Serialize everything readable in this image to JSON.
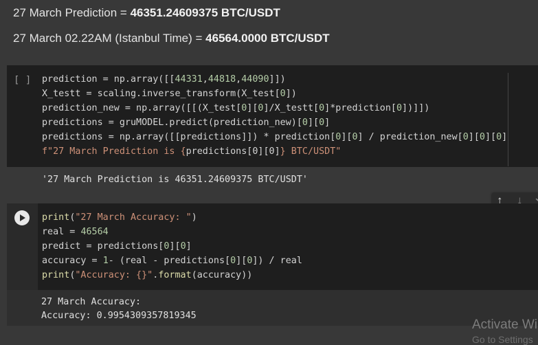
{
  "markdown": {
    "line1_prefix": "27 March Prediction = ",
    "line1_value": "46351.24609375 BTC/USDT",
    "line2_prefix": "27 March 02.22AM (Istanbul Time) = ",
    "line2_value": "46564.0000 BTC/USDT"
  },
  "cell1": {
    "exec_label": "[ ]",
    "code_lines": [
      [
        [
          "t",
          "prediction = np.array([["
        ],
        [
          "n",
          "44331"
        ],
        [
          "t",
          ","
        ],
        [
          "n",
          "44818"
        ],
        [
          "t",
          ","
        ],
        [
          "n",
          "44090"
        ],
        [
          "t",
          "]])"
        ]
      ],
      [
        [
          "t",
          "X_testt = scaling.inverse_transform(X_test["
        ],
        [
          "n",
          "0"
        ],
        [
          "t",
          "])"
        ]
      ],
      [
        [
          "t",
          "prediction_new = np.array([[(X_test["
        ],
        [
          "n",
          "0"
        ],
        [
          "t",
          "]["
        ],
        [
          "n",
          "0"
        ],
        [
          "t",
          "]/X_testt["
        ],
        [
          "n",
          "0"
        ],
        [
          "t",
          "]*prediction["
        ],
        [
          "n",
          "0"
        ],
        [
          "t",
          "])]])"
        ]
      ],
      [
        [
          "t",
          "predictions = gruMODEL.predict(prediction_new)["
        ],
        [
          "n",
          "0"
        ],
        [
          "t",
          "]["
        ],
        [
          "n",
          "0"
        ],
        [
          "t",
          "]"
        ]
      ],
      [
        [
          "t",
          "predictions = np.array([[predictions]]) * prediction["
        ],
        [
          "n",
          "0"
        ],
        [
          "t",
          "]["
        ],
        [
          "n",
          "0"
        ],
        [
          "t",
          "] / prediction_new["
        ],
        [
          "n",
          "0"
        ],
        [
          "t",
          "]["
        ],
        [
          "n",
          "0"
        ],
        [
          "t",
          "]["
        ],
        [
          "n",
          "0"
        ],
        [
          "t",
          "]"
        ]
      ],
      [
        [
          "s",
          "f\"27 March Prediction is {"
        ],
        [
          "t",
          "predictions[0][0]"
        ],
        [
          "s",
          "} BTC/USDT\""
        ]
      ]
    ],
    "output": "'27 March Prediction is 46351.24609375 BTC/USDT'"
  },
  "toolbar": {
    "up_icon": "arrow-up-icon",
    "down_icon": "arrow-down-icon"
  },
  "cell2": {
    "code_lines": [
      [
        [
          "f",
          "print"
        ],
        [
          "t",
          "("
        ],
        [
          "s",
          "\"27 March Accuracy: \""
        ],
        [
          "t",
          ")"
        ]
      ],
      [
        [
          "t",
          "real = "
        ],
        [
          "n",
          "46564"
        ]
      ],
      [
        [
          "t",
          "predict = predictions["
        ],
        [
          "n",
          "0"
        ],
        [
          "t",
          "]["
        ],
        [
          "n",
          "0"
        ],
        [
          "t",
          "]"
        ]
      ],
      [
        [
          "t",
          "accuracy = "
        ],
        [
          "n",
          "1"
        ],
        [
          "t",
          "- (real - predictions["
        ],
        [
          "n",
          "0"
        ],
        [
          "t",
          "]["
        ],
        [
          "n",
          "0"
        ],
        [
          "t",
          "]) / real"
        ]
      ],
      [
        [
          "f",
          "print"
        ],
        [
          "t",
          "("
        ],
        [
          "s",
          "\"Accuracy: {}\""
        ],
        [
          "t",
          "."
        ],
        [
          "f",
          "format"
        ],
        [
          "t",
          "(accuracy))"
        ]
      ]
    ],
    "output_line1": "27 March Accuracy:",
    "output_line2": "Accuracy: 0.9954309357819345"
  },
  "watermark": {
    "line1": "Activate Wi",
    "line2": "Go to Settings"
  }
}
